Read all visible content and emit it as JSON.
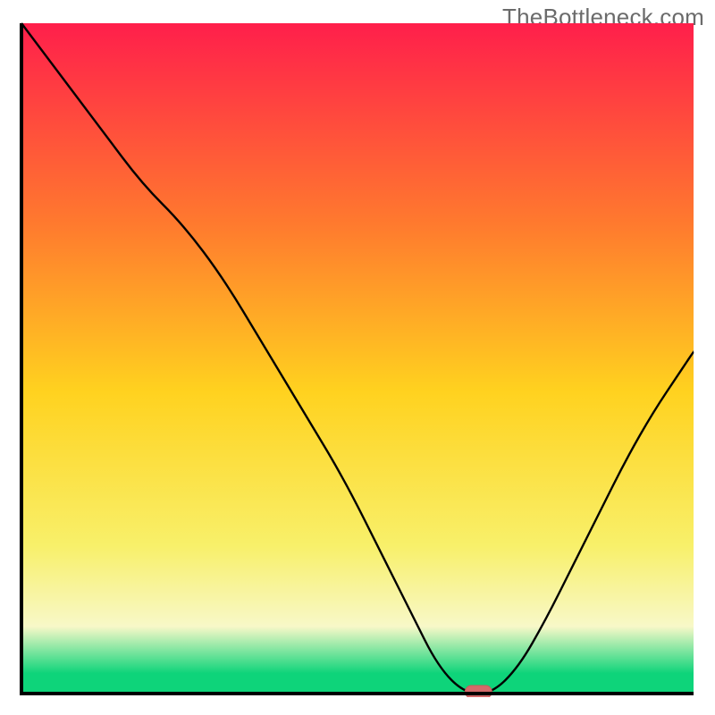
{
  "watermark": {
    "text": "TheBottleneck.com"
  },
  "colors": {
    "axis": "#000000",
    "curve": "#000000",
    "marker_fill": "#d46a6a",
    "marker_stroke": "#c85a5a",
    "gradient_top": "#ff1f4b",
    "gradient_mid_upper": "#ff7a2e",
    "gradient_mid": "#ffd21f",
    "gradient_mid_lower": "#f8f06a",
    "gradient_pale": "#f8f8c8",
    "gradient_green": "#0ed47a"
  },
  "chart_data": {
    "type": "line",
    "title": "",
    "xlabel": "",
    "ylabel": "",
    "xlim": [
      0,
      100
    ],
    "ylim": [
      0,
      100
    ],
    "series": [
      {
        "name": "bottleneck-curve",
        "x": [
          0,
          6,
          12,
          18,
          24,
          30,
          36,
          42,
          48,
          54,
          58,
          62,
          66,
          70,
          74,
          78,
          82,
          86,
          90,
          94,
          98,
          100
        ],
        "y": [
          100,
          92,
          84,
          76,
          70,
          62,
          52,
          42,
          32,
          20,
          12,
          4,
          0,
          0,
          4,
          11,
          19,
          27,
          35,
          42,
          48,
          51
        ]
      }
    ],
    "minimum_marker": {
      "x": 68,
      "y": 0
    },
    "background_gradient_stops": [
      {
        "offset": 0,
        "y": 100
      },
      {
        "offset": 0.3,
        "y": 70
      },
      {
        "offset": 0.55,
        "y": 45
      },
      {
        "offset": 0.78,
        "y": 22
      },
      {
        "offset": 0.9,
        "y": 10
      },
      {
        "offset": 0.97,
        "y": 3
      },
      {
        "offset": 1.0,
        "y": 0
      }
    ]
  }
}
